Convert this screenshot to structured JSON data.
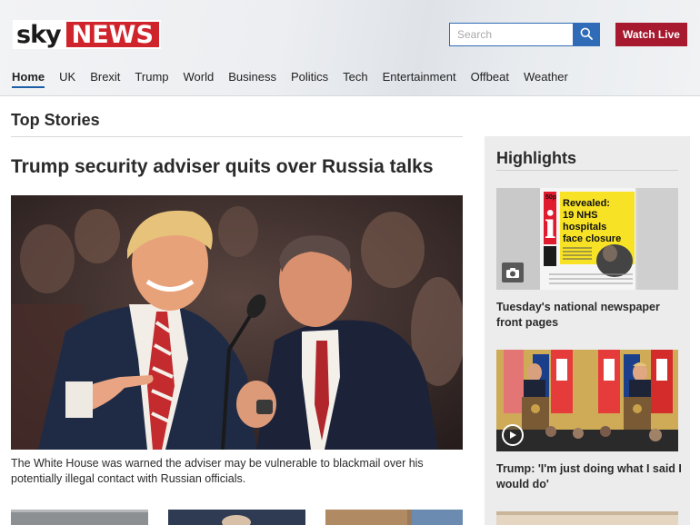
{
  "header": {
    "logo": {
      "sky": "sky",
      "news": "NEWS"
    },
    "search": {
      "placeholder": "Search",
      "value": ""
    },
    "watch_live_label": "Watch Live",
    "nav": [
      {
        "label": "Home",
        "active": true
      },
      {
        "label": "UK"
      },
      {
        "label": "Brexit"
      },
      {
        "label": "Trump"
      },
      {
        "label": "World"
      },
      {
        "label": "Business"
      },
      {
        "label": "Politics"
      },
      {
        "label": "Tech"
      },
      {
        "label": "Entertainment"
      },
      {
        "label": "Offbeat"
      },
      {
        "label": "Weather"
      }
    ]
  },
  "main": {
    "section_title": "Top Stories",
    "lead_story": {
      "headline": "Trump security adviser quits over Russia talks",
      "summary": "The White House was warned the adviser may be vulnerable to blackmail over his potentially illegal contact with Russian officials."
    }
  },
  "sidebar": {
    "title": "Highlights",
    "items": [
      {
        "caption": "Tuesday's national newspaper front pages",
        "media_icon": "camera-icon",
        "image_text": {
          "price": "50p",
          "masthead": "i",
          "headline": "Revealed: 19 NHS hospitals face closure"
        }
      },
      {
        "caption": "Trump: 'I'm just doing what I said I would do'",
        "media_icon": "play-icon"
      }
    ]
  },
  "colors": {
    "brand_red": "#d0242c",
    "watch_live": "#a6192e",
    "search_blue": "#2f6bb6",
    "nav_active": "#1c5fa8",
    "sidebar_bg": "#ececec"
  }
}
